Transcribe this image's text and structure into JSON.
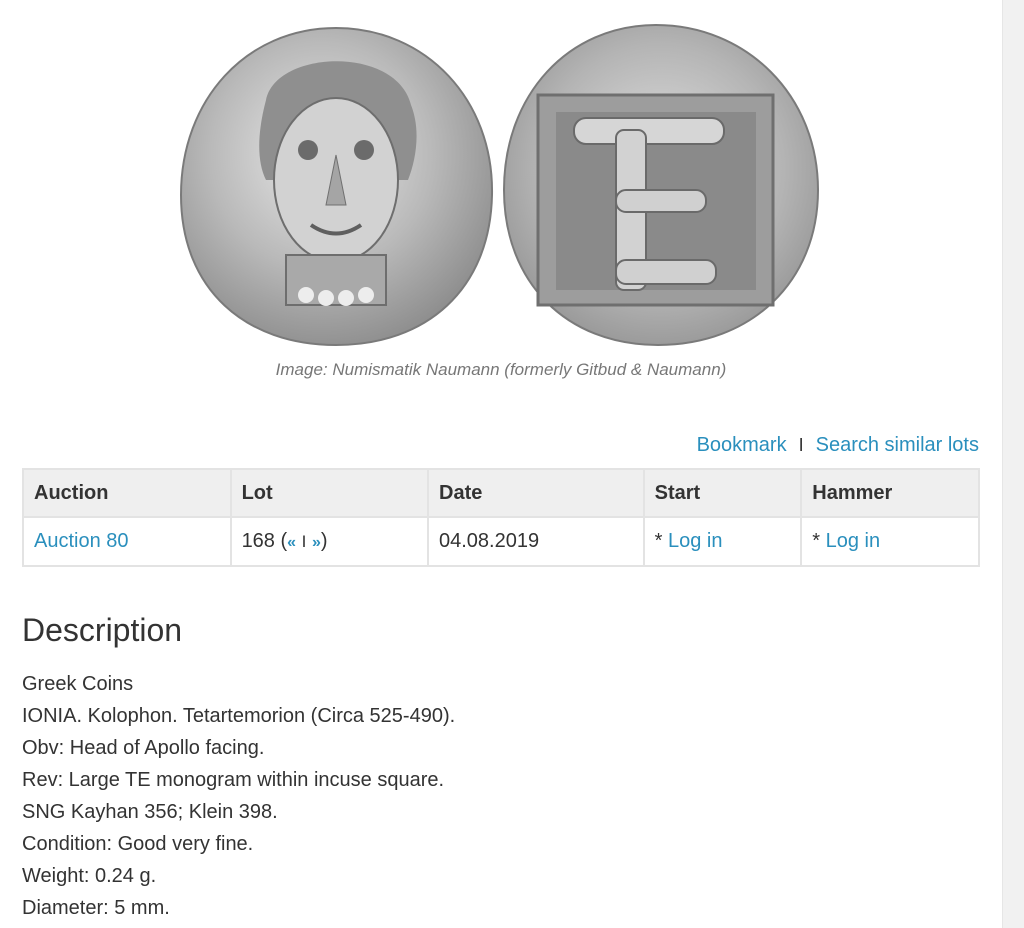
{
  "image": {
    "caption": "Image: Numismatik Naumann (formerly Gitbud & Naumann)",
    "obverse_icon": "coin-obverse-head-of-apollo",
    "reverse_icon": "coin-reverse-te-monogram"
  },
  "actions": {
    "bookmark": "Bookmark",
    "separator": "I",
    "search_similar": "Search similar lots"
  },
  "table": {
    "headers": [
      "Auction",
      "Lot",
      "Date",
      "Start",
      "Hammer"
    ],
    "row": {
      "auction": "Auction 80",
      "lot_number": "168",
      "prev": "«",
      "nav_sep": "I",
      "next": "»",
      "date": "04.08.2019",
      "start_prefix": "*",
      "start_link": "Log in",
      "hammer_prefix": "*",
      "hammer_link": "Log in"
    }
  },
  "description": {
    "title": "Description",
    "lines": [
      "Greek Coins",
      "IONIA. Kolophon. Tetartemorion (Circa 525-490).",
      "Obv: Head of Apollo facing.",
      "Rev: Large TE monogram within incuse square.",
      "SNG Kayhan 356; Klein 398.",
      "Condition: Good very fine.",
      "Weight: 0.24 g.",
      "Diameter: 5 mm."
    ]
  },
  "colors": {
    "link": "#2a8fbd",
    "header_bg": "#efefef",
    "border": "#e3e3e3",
    "text": "#333333",
    "caption": "#777777"
  }
}
